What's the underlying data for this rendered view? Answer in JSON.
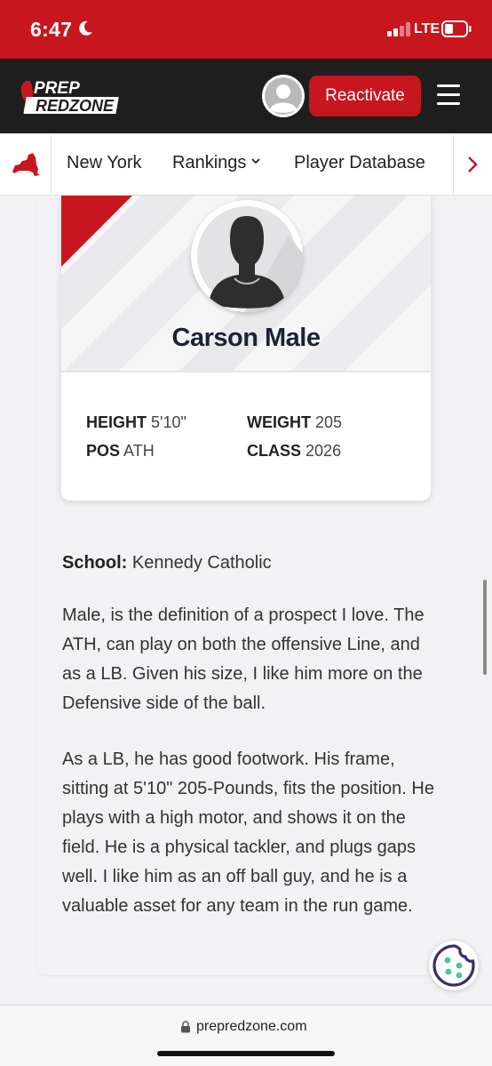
{
  "status_bar": {
    "time": "6:47",
    "network": "LTE",
    "icons": [
      "moon-icon",
      "signal-icon",
      "battery-icon"
    ]
  },
  "header": {
    "logo_line1": "PREP",
    "logo_line2": "REDZONE",
    "reactivate_label": "Reactivate",
    "icons": [
      "avatar-icon",
      "hamburger-menu-icon"
    ]
  },
  "nav": {
    "state_icon": "new-york-state-icon",
    "items": [
      {
        "label": "New York"
      },
      {
        "label": "Rankings",
        "has_dropdown": true
      },
      {
        "label": "Player Database"
      }
    ],
    "next_icon": "chevron-right-icon"
  },
  "player": {
    "name": "Carson Male",
    "stats": {
      "height_label": "HEIGHT",
      "height_value": "5'10\"",
      "weight_label": "WEIGHT",
      "weight_value": "205",
      "pos_label": "POS",
      "pos_value": "ATH",
      "class_label": "CLASS",
      "class_value": "2026"
    }
  },
  "article": {
    "school_label": "School:",
    "school_value": "Kennedy Catholic",
    "paragraphs": [
      "Male, is the definition of a prospect I love. The ATH, can play on both the offensive Line, and as a LB. Given his size, I like him more on the Defensive side of the ball.",
      "As a LB, he has good footwork. His frame, sitting at 5'10\" 205-Pounds, fits the position. He plays with a high motor, and shows it on the field. He is a physical tackler, and plugs gaps well. I like him as an off ball guy, and he is a valuable asset for any team in the run game."
    ]
  },
  "browser": {
    "url": "prepredzone.com"
  },
  "colors": {
    "brand_red": "#c8161e",
    "header_dark": "#1e1e1e",
    "name_navy": "#1c2333",
    "cookie_purple": "#3d2d6b",
    "cookie_green": "#46c98c"
  }
}
